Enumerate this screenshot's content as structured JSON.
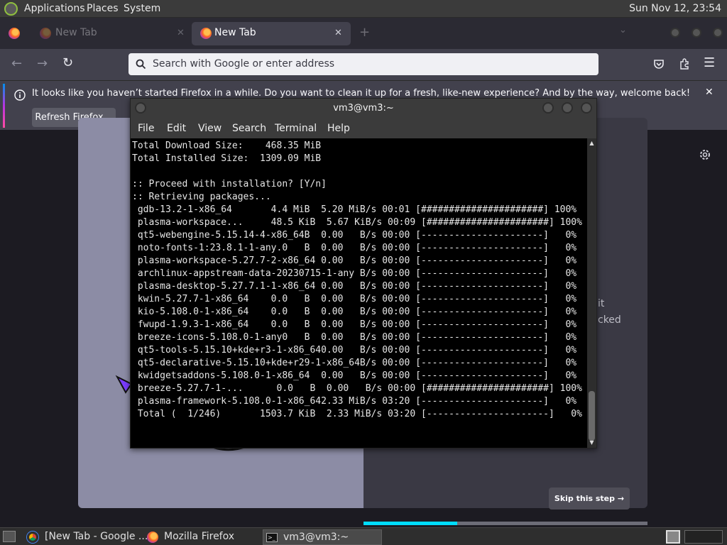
{
  "top_panel": {
    "menus": [
      "Applications",
      "Places",
      "System"
    ],
    "clock": "Sun Nov 12, 23:54"
  },
  "browser": {
    "tabs": [
      {
        "label": ""
      },
      {
        "label": "New Tab"
      },
      {
        "label": "New Tab"
      }
    ],
    "url_placeholder": "Search with Google or enter address",
    "notification": {
      "text": "It looks like you haven’t started Firefox in a while. Do you want to clean it up for a fresh, like-new experience? And by the way, welcome back!",
      "button": "Refresh Firefox…"
    },
    "content": {
      "partial_text_1": "it",
      "partial_text_2": "cked",
      "skip_button": "Skip this step →",
      "progress_fraction": 0.33
    }
  },
  "terminal": {
    "title": "vm3@vm3:~",
    "menus": [
      "File",
      "Edit",
      "View",
      "Search",
      "Terminal",
      "Help"
    ],
    "lines": [
      "Total Download Size:    468.35 MiB",
      "Total Installed Size:  1309.09 MiB",
      "",
      ":: Proceed with installation? [Y/n]",
      ":: Retrieving packages...",
      " gdb-13.2-1-x86_64       4.4 MiB  5.20 MiB/s 00:01 [######################] 100%",
      " plasma-workspace...     48.5 KiB  5.67 KiB/s 00:09 [######################] 100%",
      " qt5-webengine-5.15.14-4-x86_64B  0.00   B/s 00:00 [----------------------]   0%",
      " noto-fonts-1:23.8.1-1-any.0   B  0.00   B/s 00:00 [----------------------]   0%",
      " plasma-workspace-5.27.7-2-x86_64 0.00   B/s 00:00 [----------------------]   0%",
      " archlinux-appstream-data-20230715-1-any B/s 00:00 [----------------------]   0%",
      " plasma-desktop-5.27.7.1-1-x86_64 0.00   B/s 00:00 [----------------------]   0%",
      " kwin-5.27.7-1-x86_64    0.0   B  0.00   B/s 00:00 [----------------------]   0%",
      " kio-5.108.0-1-x86_64    0.0   B  0.00   B/s 00:00 [----------------------]   0%",
      " fwupd-1.9.3-1-x86_64    0.0   B  0.00   B/s 00:00 [----------------------]   0%",
      " breeze-icons-5.108.0-1-any0   B  0.00   B/s 00:00 [----------------------]   0%",
      " qt5-tools-5.15.10+kde+r3-1-x86_640.00   B/s 00:00 [----------------------]   0%",
      " qt5-declarative-5.15.10+kde+r29-1-x86_64B/s 00:00 [----------------------]   0%",
      " kwidgetsaddons-5.108.0-1-x86_64  0.00   B/s 00:00 [----------------------]   0%",
      " breeze-5.27.7-1-...      0.0   B  0.00   B/s 00:00 [######################] 100%",
      " plasma-framework-5.108.0-1-x86_642.33 MiB/s 03:20 [----------------------]   0%",
      " Total (  1/246)       1503.7 KiB  2.33 MiB/s 03:20 [----------------------]   0%"
    ]
  },
  "taskbar": {
    "items": [
      {
        "label": "[New Tab - Google ..."
      },
      {
        "label": "Mozilla Firefox"
      },
      {
        "label": "vm3@vm3:~"
      }
    ]
  }
}
